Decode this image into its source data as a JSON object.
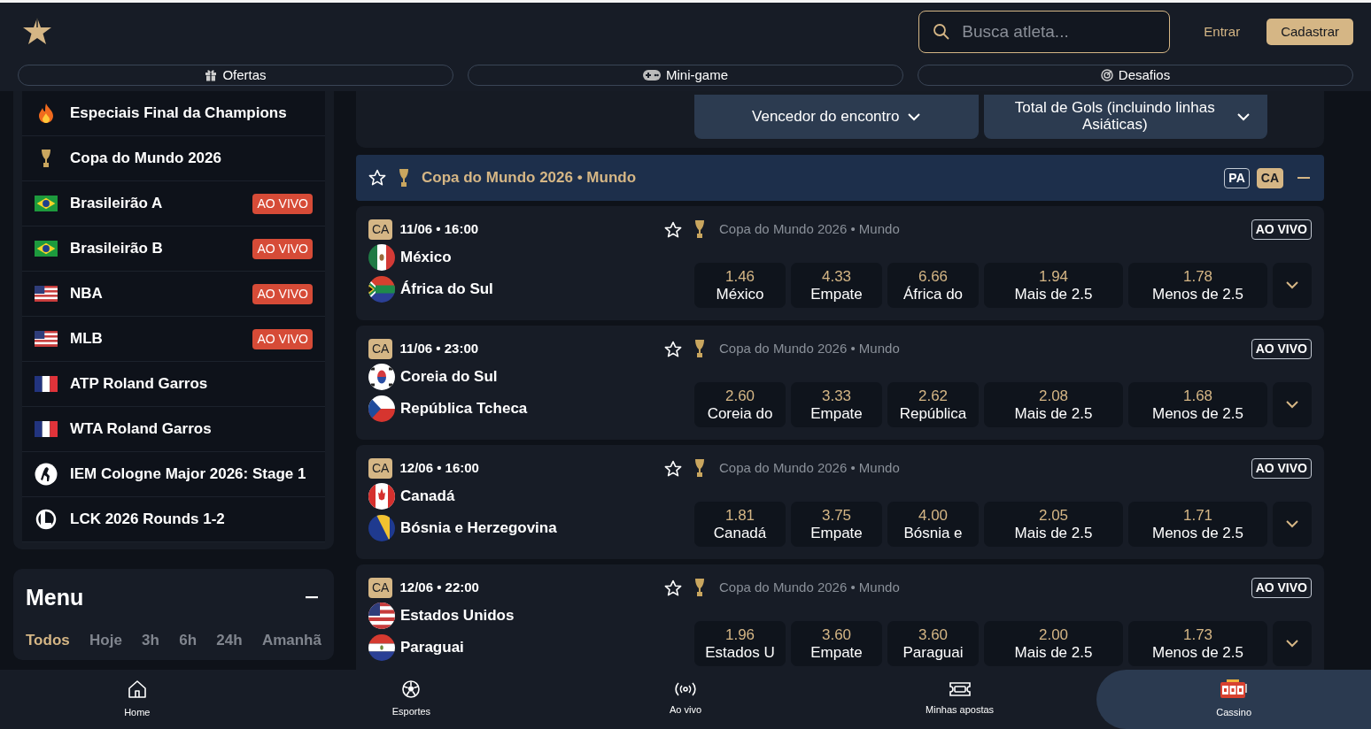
{
  "header": {
    "search": {
      "placeholder": "Busca atleta..."
    },
    "login": "Entrar",
    "signup": "Cadastrar"
  },
  "quick_links": [
    {
      "label": "Ofertas"
    },
    {
      "label": "Mini-game"
    },
    {
      "label": "Desafios"
    }
  ],
  "sidebar": {
    "leagues": [
      {
        "name": "Especiais Final da Champions"
      },
      {
        "name": "Copa do Mundo 2026"
      },
      {
        "name": "Brasileirão A",
        "badge": "AO VIVO"
      },
      {
        "name": "Brasileirão B",
        "badge": "AO VIVO"
      },
      {
        "name": "NBA",
        "badge": "AO VIVO"
      },
      {
        "name": "MLB",
        "badge": "AO VIVO"
      },
      {
        "name": "ATP Roland Garros"
      },
      {
        "name": "WTA Roland Garros"
      },
      {
        "name": "IEM Cologne Major 2026: Stage 1"
      },
      {
        "name": "LCK 2026 Rounds 1-2"
      }
    ]
  },
  "menu": {
    "title": "Menu",
    "filters": [
      {
        "label": "Todos",
        "selected": true
      },
      {
        "label": "Hoje",
        "selected": false
      },
      {
        "label": "3h",
        "selected": false
      },
      {
        "label": "6h",
        "selected": false
      },
      {
        "label": "24h",
        "selected": false
      },
      {
        "label": "Amanhã",
        "selected": false
      }
    ]
  },
  "markets": [
    "Vencedor do encontro",
    "Total de Gols (incluindo linhas Asiáticas)"
  ],
  "league_header": {
    "title": "Copa do Mundo 2026 • Mundo",
    "favorite": false,
    "badges": [
      {
        "label": "PA",
        "selected": false
      },
      {
        "label": "CA",
        "selected": true
      }
    ]
  },
  "matches": [
    {
      "code": "CA",
      "time": "11/06 • 16:00",
      "favorite": false,
      "competition": "Copa do Mundo 2026 • Mundo",
      "live": "AO VIVO",
      "teams": [
        {
          "name": "México"
        },
        {
          "name": "África do Sul"
        }
      ],
      "odds": [
        {
          "value": "1.46",
          "label": "México"
        },
        {
          "value": "4.33",
          "label": "Empate"
        },
        {
          "value": "6.66",
          "label": "África do"
        },
        {
          "value": "1.94",
          "label": "Mais de 2.5"
        },
        {
          "value": "1.78",
          "label": "Menos de 2.5"
        }
      ]
    },
    {
      "code": "CA",
      "time": "11/06 • 23:00",
      "favorite": false,
      "competition": "Copa do Mundo 2026 • Mundo",
      "live": "AO VIVO",
      "teams": [
        {
          "name": "Coreia do Sul"
        },
        {
          "name": "República Tcheca"
        }
      ],
      "odds": [
        {
          "value": "2.60",
          "label": "Coreia do"
        },
        {
          "value": "3.33",
          "label": "Empate"
        },
        {
          "value": "2.62",
          "label": "República"
        },
        {
          "value": "2.08",
          "label": "Mais de 2.5"
        },
        {
          "value": "1.68",
          "label": "Menos de 2.5"
        }
      ]
    },
    {
      "code": "CA",
      "time": "12/06 • 16:00",
      "favorite": false,
      "competition": "Copa do Mundo 2026 • Mundo",
      "live": "AO VIVO",
      "teams": [
        {
          "name": "Canadá"
        },
        {
          "name": "Bósnia e Herzegovina"
        }
      ],
      "odds": [
        {
          "value": "1.81",
          "label": "Canadá"
        },
        {
          "value": "3.75",
          "label": "Empate"
        },
        {
          "value": "4.00",
          "label": "Bósnia e"
        },
        {
          "value": "2.05",
          "label": "Mais de 2.5"
        },
        {
          "value": "1.71",
          "label": "Menos de 2.5"
        }
      ]
    },
    {
      "code": "CA",
      "time": "12/06 • 22:00",
      "favorite": false,
      "competition": "Copa do Mundo 2026 • Mundo",
      "live": "AO VIVO",
      "teams": [
        {
          "name": "Estados Unidos"
        },
        {
          "name": "Paraguai"
        }
      ],
      "odds": [
        {
          "value": "1.96",
          "label": "Estados U"
        },
        {
          "value": "3.60",
          "label": "Empate"
        },
        {
          "value": "3.60",
          "label": "Paraguai"
        },
        {
          "value": "2.00",
          "label": "Mais de 2.5"
        },
        {
          "value": "1.73",
          "label": "Menos de 2.5"
        }
      ]
    }
  ],
  "bottom_nav": [
    {
      "label": "Home",
      "selected": false
    },
    {
      "label": "Esportes",
      "selected": false
    },
    {
      "label": "Ao vivo",
      "selected": false
    },
    {
      "label": "Minhas apostas",
      "selected": false
    },
    {
      "label": "Cassino",
      "selected": true
    }
  ]
}
